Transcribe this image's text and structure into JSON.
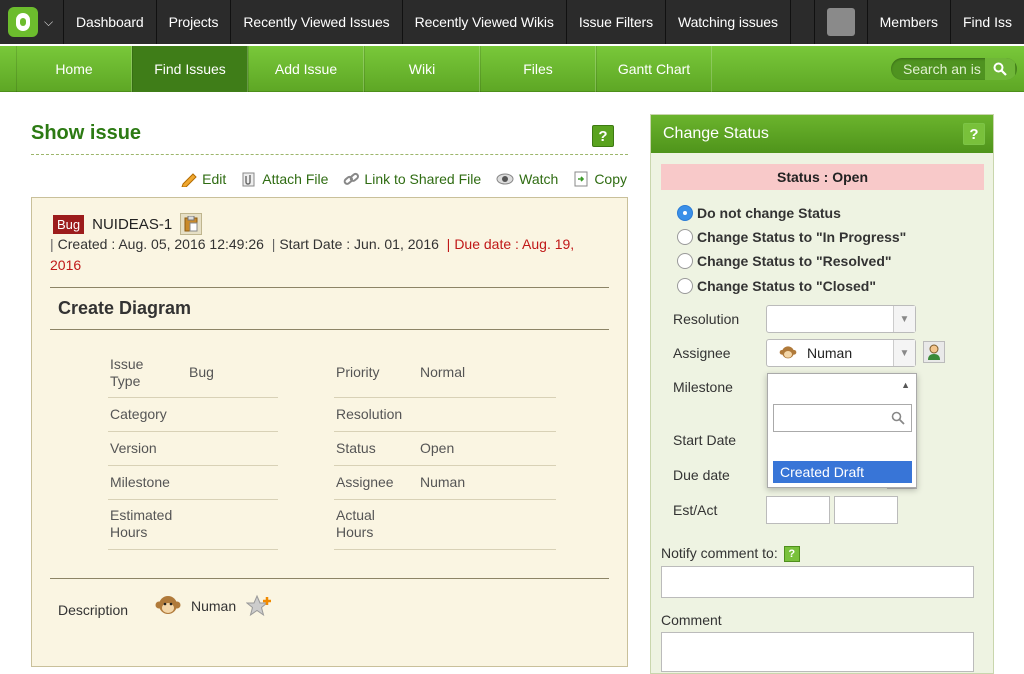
{
  "topnav": {
    "items": [
      "Dashboard",
      "Projects",
      "Recently Viewed Issues",
      "Recently Viewed Wikis",
      "Issue Filters",
      "Watching issues"
    ],
    "right": [
      "Members",
      "Find Iss"
    ]
  },
  "projnav": {
    "tabs": [
      "Home",
      "Find Issues",
      "Add Issue",
      "Wiki",
      "Files",
      "Gantt Chart"
    ],
    "search_placeholder": "Search an is"
  },
  "issue": {
    "page_title": "Show issue",
    "help": "?",
    "actions": [
      "Edit",
      "Attach File",
      "Link to Shared File",
      "Watch",
      "Copy"
    ],
    "type": "Bug",
    "key": "NUIDEAS-1",
    "created": "Created : Aug. 05, 2016 12:49:26",
    "start": "Start Date : Jun. 01, 2016",
    "due": "Due date : Aug. 19, 2016",
    "summary": "Create Diagram",
    "left_attrs": [
      {
        "label": "Issue Type",
        "value": "Bug"
      },
      {
        "label": "Category",
        "value": ""
      },
      {
        "label": "Version",
        "value": ""
      },
      {
        "label": "Milestone",
        "value": ""
      },
      {
        "label": "Estimated Hours",
        "value": ""
      }
    ],
    "right_attrs": [
      {
        "label": "Priority",
        "value": "Normal"
      },
      {
        "label": "Resolution",
        "value": ""
      },
      {
        "label": "Status",
        "value": "Open"
      },
      {
        "label": "Assignee",
        "value": "Numan"
      },
      {
        "label": "Actual Hours",
        "value": ""
      }
    ],
    "description_label": "Description",
    "description_user": "Numan"
  },
  "panel": {
    "title": "Change Status",
    "help": "?",
    "status": "Status : Open",
    "radios": [
      "Do not change Status",
      "Change Status to \"In Progress\"",
      "Change Status to \"Resolved\"",
      "Change Status to \"Closed\""
    ],
    "labels": {
      "resolution": "Resolution",
      "assignee": "Assignee",
      "milestone": "Milestone",
      "start_date": "Start Date",
      "due_date": "Due date",
      "est_act": "Est/Act",
      "notify": "Notify comment to:",
      "comment": "Comment"
    },
    "assignee_value": "Numan",
    "dropdown_option": "Created Draft"
  },
  "colors": {
    "green": "#5ea725",
    "dark_green": "#3f7d18",
    "topbar": "#2b2b2b",
    "bug_red": "#9c1c1c",
    "due_red": "#c01818",
    "status_pink": "#f8c9c9"
  }
}
